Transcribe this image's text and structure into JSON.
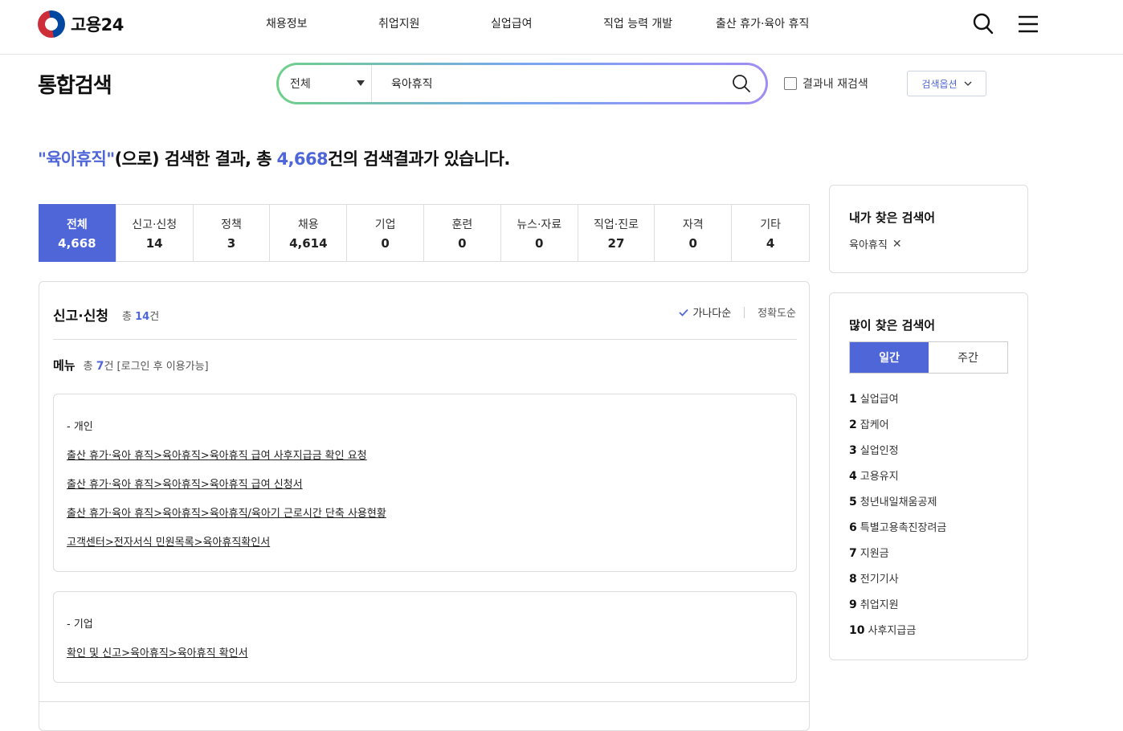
{
  "header": {
    "logo_text": "고용24",
    "nav": [
      "채용정보",
      "취업지원",
      "실업급여",
      "직업 능력 개발",
      "출산 휴가·육아 휴직"
    ]
  },
  "page_title": "통합검색",
  "search": {
    "scope": "전체",
    "query": "육아휴직",
    "re_search_label": "결과내 재검색",
    "options_label": "검색옵션"
  },
  "summary": {
    "query_quoted": "\"육아휴직\"",
    "prefix": "(으로) 검색한 결과, 총 ",
    "total": "4,668",
    "suffix": "건의 검색결과가 있습니다."
  },
  "categories": [
    {
      "label": "전체",
      "count": "4,668"
    },
    {
      "label": "신고·신청",
      "count": "14"
    },
    {
      "label": "정책",
      "count": "3"
    },
    {
      "label": "채용",
      "count": "4,614"
    },
    {
      "label": "기업",
      "count": "0"
    },
    {
      "label": "훈련",
      "count": "0"
    },
    {
      "label": "뉴스·자료",
      "count": "0"
    },
    {
      "label": "직업·진로",
      "count": "27"
    },
    {
      "label": "자격",
      "count": "0"
    },
    {
      "label": "기타",
      "count": "4"
    }
  ],
  "panel": {
    "title": "신고·신청",
    "count_prefix": "총 ",
    "count": "14",
    "count_suffix": "건",
    "sort": [
      "가나다순",
      "정확도순"
    ],
    "menu_label": "메뉴",
    "menu_prefix": "총 ",
    "menu_count": "7",
    "menu_suffix": "건 [로그인 후 이용가능]",
    "groups": [
      {
        "label": "- 개인",
        "links": [
          "출산 휴가·육아 휴직>육아휴직>육아휴직 급여 사후지급금 확인 요청",
          "출산 휴가·육아 휴직>육아휴직>육아휴직 급여 신청서",
          "출산 휴가·육아 휴직>육아휴직>육아휴직/육아기 근로시간 단축 사용현황",
          "고객센터>전자서식 민원목록>육아휴직확인서"
        ]
      },
      {
        "label": "- 기업",
        "links": [
          "확인 및 신고>육아휴직>육아휴직 확인서"
        ]
      }
    ]
  },
  "my_keywords": {
    "title": "내가 찾은 검색어",
    "items": [
      "육아휴직"
    ]
  },
  "popular": {
    "title": "많이 찾은 검색어",
    "tabs": [
      "일간",
      "주간"
    ],
    "items": [
      {
        "rank": "1",
        "text": "실업급여"
      },
      {
        "rank": "2",
        "text": "잡케어"
      },
      {
        "rank": "3",
        "text": "실업인정"
      },
      {
        "rank": "4",
        "text": "고용유지"
      },
      {
        "rank": "5",
        "text": "청년내일채움공제"
      },
      {
        "rank": "6",
        "text": "특별고용촉진장려금"
      },
      {
        "rank": "7",
        "text": "지원금"
      },
      {
        "rank": "8",
        "text": "전기기사"
      },
      {
        "rank": "9",
        "text": "취업지원"
      },
      {
        "rank": "10",
        "text": "사후지급금"
      }
    ]
  }
}
